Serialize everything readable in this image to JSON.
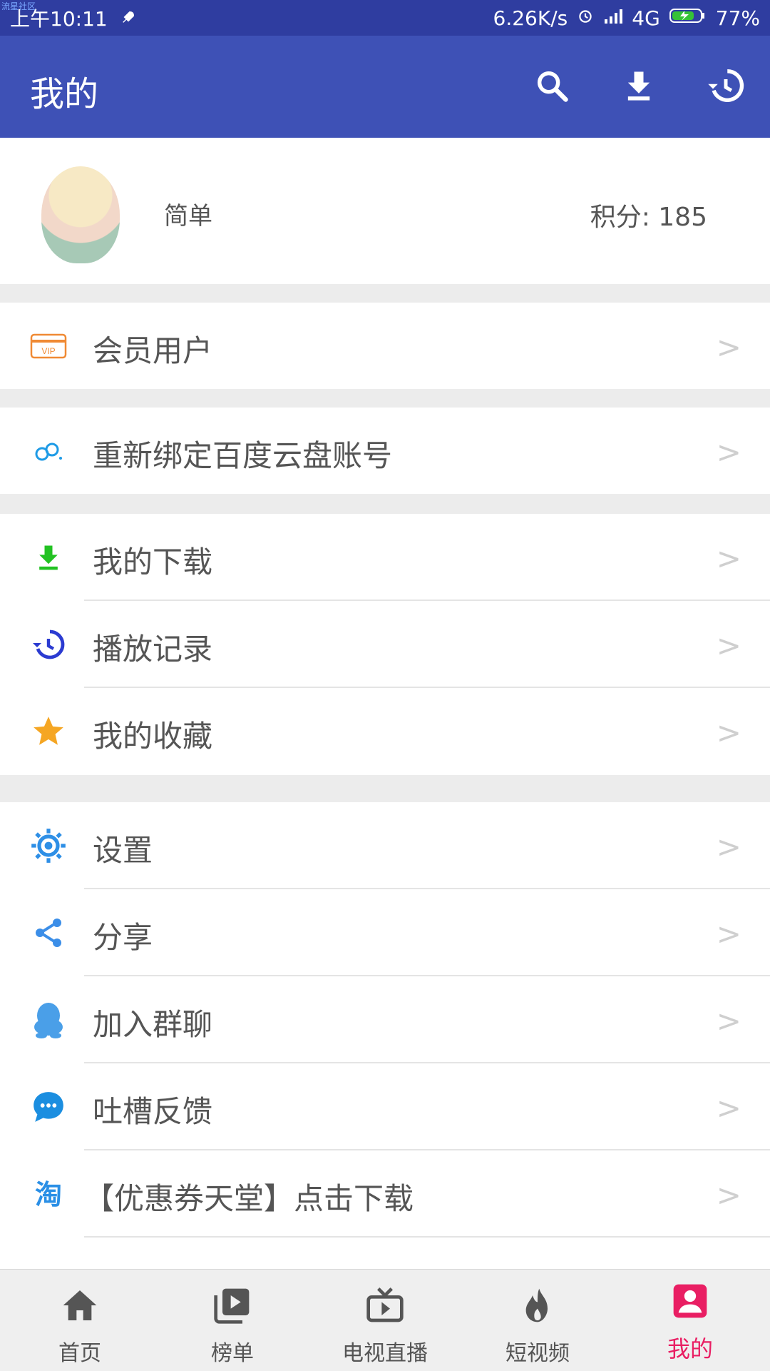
{
  "status_bar": {
    "watermark": "流星社区",
    "time": "上午10:11",
    "net_speed": "6.26K/s",
    "network": "4G",
    "battery": "77%"
  },
  "appbar": {
    "title": "我的",
    "icons": [
      "search-icon",
      "download-icon",
      "history-icon"
    ]
  },
  "profile": {
    "username": "简单",
    "points_label": "积分:",
    "points_value": "185"
  },
  "menu": [
    {
      "label": "会员用户"
    },
    {
      "label": "重新绑定百度云盘账号"
    },
    {
      "label": "我的下载"
    },
    {
      "label": "播放记录"
    },
    {
      "label": "我的收藏"
    },
    {
      "label": "设置"
    },
    {
      "label": "分享"
    },
    {
      "label": "加入群聊"
    },
    {
      "label": "吐槽反馈"
    },
    {
      "label": "【优惠券天堂】点击下载"
    }
  ],
  "chevron": ">",
  "bottom_nav": [
    {
      "label": "首页"
    },
    {
      "label": "榜单"
    },
    {
      "label": "电视直播"
    },
    {
      "label": "短视频"
    },
    {
      "label": "我的"
    }
  ],
  "colors": {
    "status_bar": "#2f3da0",
    "appbar": "#3e51b6",
    "active_tab": "#e91e63",
    "download_green": "#22c222",
    "history_blue": "#2b3bd1",
    "star": "#f5a623",
    "settings_blue": "#2e8fe6"
  }
}
